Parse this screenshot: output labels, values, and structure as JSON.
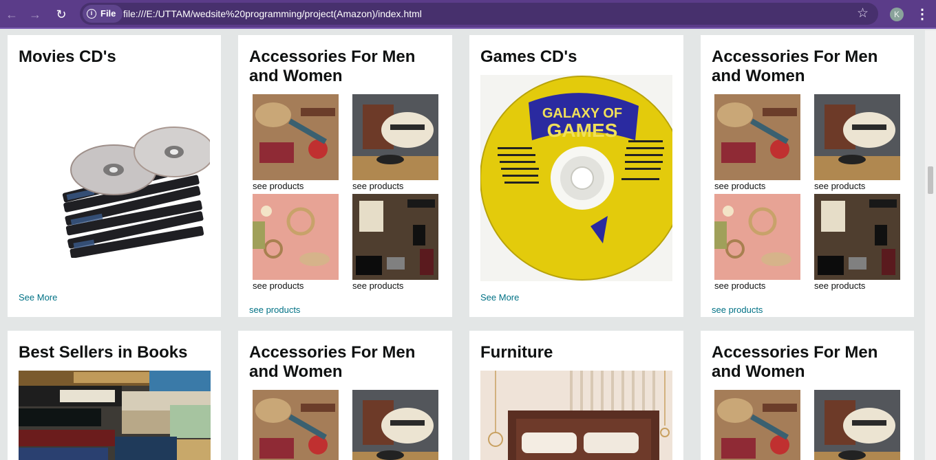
{
  "browser": {
    "chip_label": "File",
    "url": "file:///E:/UTTAM/wedsite%20programming/project(Amazon)/index.html",
    "avatar_letter": "K",
    "icons": [
      "back-arrow-icon",
      "forward-arrow-icon",
      "reload-icon",
      "info-icon",
      "star-icon",
      "menu-icon"
    ]
  },
  "row1": {
    "movies": {
      "title": "Movies CD's",
      "link": "See More"
    },
    "accessories_a": {
      "title": "Accessories For Men and Women",
      "item1": "see products",
      "item2": "see products",
      "item3": "see products",
      "item4": "see products",
      "link": "see products"
    },
    "games": {
      "title": "Games CD's",
      "link": "See More"
    },
    "accessories_b": {
      "title": "Accessories For Men and Women",
      "item1": "see products",
      "item2": "see products",
      "item3": "see products",
      "item4": "see products",
      "link": "see products"
    }
  },
  "row2": {
    "books": {
      "title": "Best Sellers in Books"
    },
    "accessories_c": {
      "title": "Accessories For Men and Women"
    },
    "furniture": {
      "title": "Furniture"
    },
    "accessories_d": {
      "title": "Accessories For Men and Women"
    }
  },
  "colors": {
    "toolbar": "#5b3c89",
    "page_bg": "#e3e6e6",
    "link": "#007185",
    "cd_yellow": "#e8d110"
  }
}
